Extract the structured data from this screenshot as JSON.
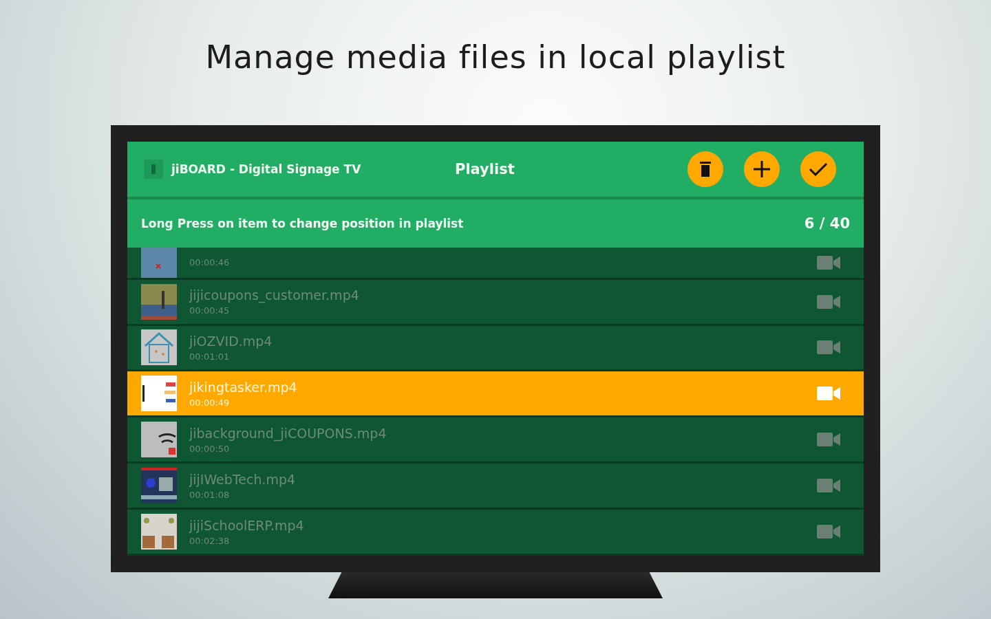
{
  "caption": "Manage media files in local playlist",
  "app_bar": {
    "app_name": "jiBOARD - Digital Signage TV",
    "title": "Playlist",
    "actions": [
      {
        "kind": "delete"
      },
      {
        "kind": "add"
      },
      {
        "kind": "confirm"
      }
    ]
  },
  "hint_bar": {
    "text": "Long Press on item to change position in playlist",
    "counter": "6 / 40"
  },
  "items": [
    {
      "duration": "00:00:46",
      "selected": false
    },
    {
      "name": "jijicoupons_customer.mp4",
      "duration": "00:00:45",
      "selected": false
    },
    {
      "name": "jiOZVID.mp4",
      "duration": "00:01:01",
      "selected": false
    },
    {
      "name": "jikingtasker.mp4",
      "duration": "00:00:49",
      "selected": true
    },
    {
      "name": "jibackground_jiCOUPONS.mp4",
      "duration": "00:00:50",
      "selected": false
    },
    {
      "name": "jijIWebTech.mp4",
      "duration": "00:01:08",
      "selected": false
    },
    {
      "name": "jijiSchoolERP.mp4",
      "duration": "00:02:38",
      "selected": false
    }
  ]
}
